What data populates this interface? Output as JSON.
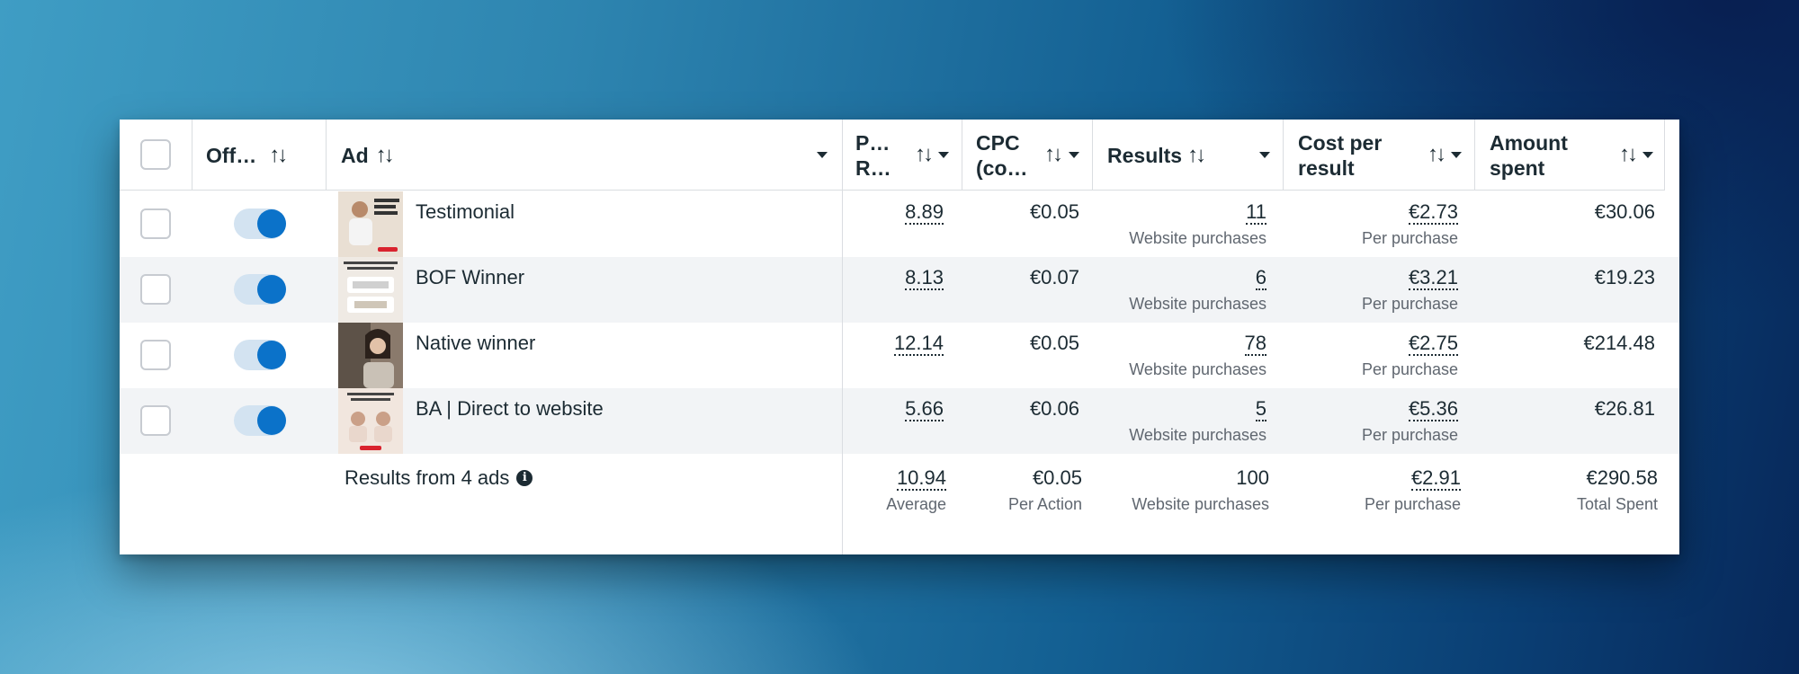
{
  "header": {
    "offon_label": "Off…",
    "ad_label": "Ad",
    "pr_line1": "P…",
    "pr_line2": "R…",
    "cpc_line1": "CPC",
    "cpc_line2": "(co…",
    "results_label": "Results",
    "cpr_line1": "Cost per",
    "cpr_line2": "result",
    "amount_line1": "Amount",
    "amount_line2": "spent",
    "sort_icon": "sort-icon",
    "caret_icon": "caret-down-icon"
  },
  "rows": [
    {
      "ad": "Testimonial",
      "toggle_on": true,
      "pr": "8.89",
      "cpc": "€0.05",
      "results": "11",
      "results_sub": "Website purchases",
      "cpr": "€2.73",
      "cpr_sub": "Per purchase",
      "amount": "€30.06"
    },
    {
      "ad": "BOF Winner",
      "toggle_on": true,
      "pr": "8.13",
      "cpc": "€0.07",
      "results": "6",
      "results_sub": "Website purchases",
      "cpr": "€3.21",
      "cpr_sub": "Per purchase",
      "amount": "€19.23"
    },
    {
      "ad": "Native winner",
      "toggle_on": true,
      "pr": "12.14",
      "cpc": "€0.05",
      "results": "78",
      "results_sub": "Website purchases",
      "cpr": "€2.75",
      "cpr_sub": "Per purchase",
      "amount": "€214.48"
    },
    {
      "ad": "BA | Direct to website",
      "toggle_on": true,
      "pr": "5.66",
      "cpc": "€0.06",
      "results": "5",
      "results_sub": "Website purchases",
      "cpr": "€5.36",
      "cpr_sub": "Per purchase",
      "amount": "€26.81"
    }
  ],
  "footer": {
    "label": "Results from 4 ads",
    "pr": "10.94",
    "pr_sub": "Average",
    "cpc": "€0.05",
    "cpc_sub": "Per Action",
    "results": "100",
    "results_sub": "Website purchases",
    "cpr": "€2.91",
    "cpr_sub": "Per purchase",
    "amount": "€290.58",
    "amount_sub": "Total Spent"
  },
  "colors": {
    "accent": "#0b72c9",
    "toggle_track": "#d3e3f1",
    "row_alt": "#f2f4f6",
    "text": "#1c2b33",
    "muted": "#606770"
  }
}
